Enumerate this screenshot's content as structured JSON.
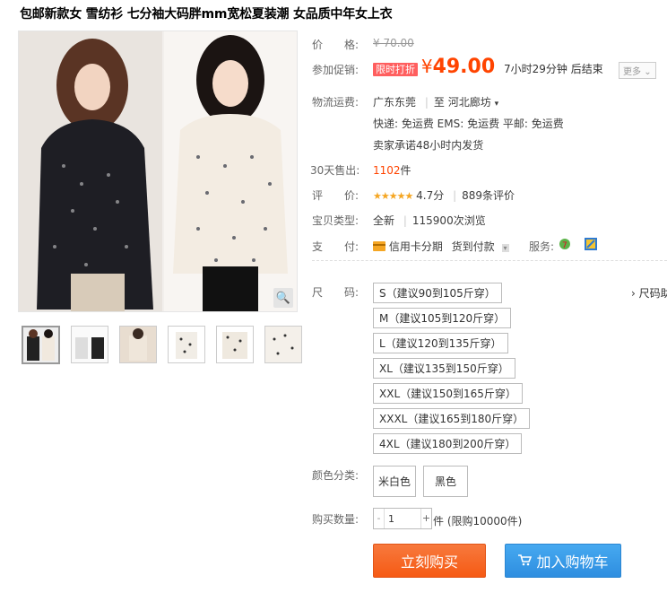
{
  "title": "包邮新款女 雪纺衫 七分袖大码胖mm宽松夏装潮 女品质中年女上衣",
  "price": {
    "label": "价　　格:",
    "original": "¥ 70.00"
  },
  "promo": {
    "label": "参加促销:",
    "tag": "限时打折",
    "yen": "¥",
    "value": "49.00",
    "countdown": "7小时29分钟 后结束",
    "more": "更多"
  },
  "logistics": {
    "label": "物流运费:",
    "from": "广东东莞",
    "to_prefix": "至",
    "to": "河北廊坊",
    "fees": "快递: 免运费  EMS: 免运费  平邮: 免运费",
    "promise": "卖家承诺48小时内发货"
  },
  "sales": {
    "label": "30天售出:",
    "count": "1102",
    "unit": "件"
  },
  "rating": {
    "label": "评　　价:",
    "stars": "★★★★★",
    "score": "4.7分",
    "reviews": "889条评价"
  },
  "type": {
    "label": "宝贝类型:",
    "value": "全新",
    "views": "115900次浏览"
  },
  "payment": {
    "label": "支　　付:",
    "credit": "信用卡分期",
    "cod": "货到付款",
    "service_label": "服务:"
  },
  "size": {
    "label": "尺　　码:",
    "chart_link": "› 尺码助",
    "options": [
      "S（建议90到105斤穿）",
      "M（建议105到120斤穿）",
      "L（建议120到135斤穿）",
      "XL（建议135到150斤穿）",
      "XXL（建议150到165斤穿）",
      "XXXL（建议165到180斤穿）",
      "4XL（建议180到200斤穿）"
    ]
  },
  "color": {
    "label": "颜色分类:",
    "options": [
      "米白色",
      "黑色"
    ]
  },
  "quantity": {
    "label": "购买数量:",
    "value": "1",
    "stock": "件 (限购10000件)",
    "minus": "-",
    "plus": "+"
  },
  "buttons": {
    "buy": "立刻购买",
    "cart": "加入购物车"
  },
  "colors": {
    "accent": "#ff4400",
    "buy": "#f65a14",
    "cart": "#2e8ee0"
  }
}
